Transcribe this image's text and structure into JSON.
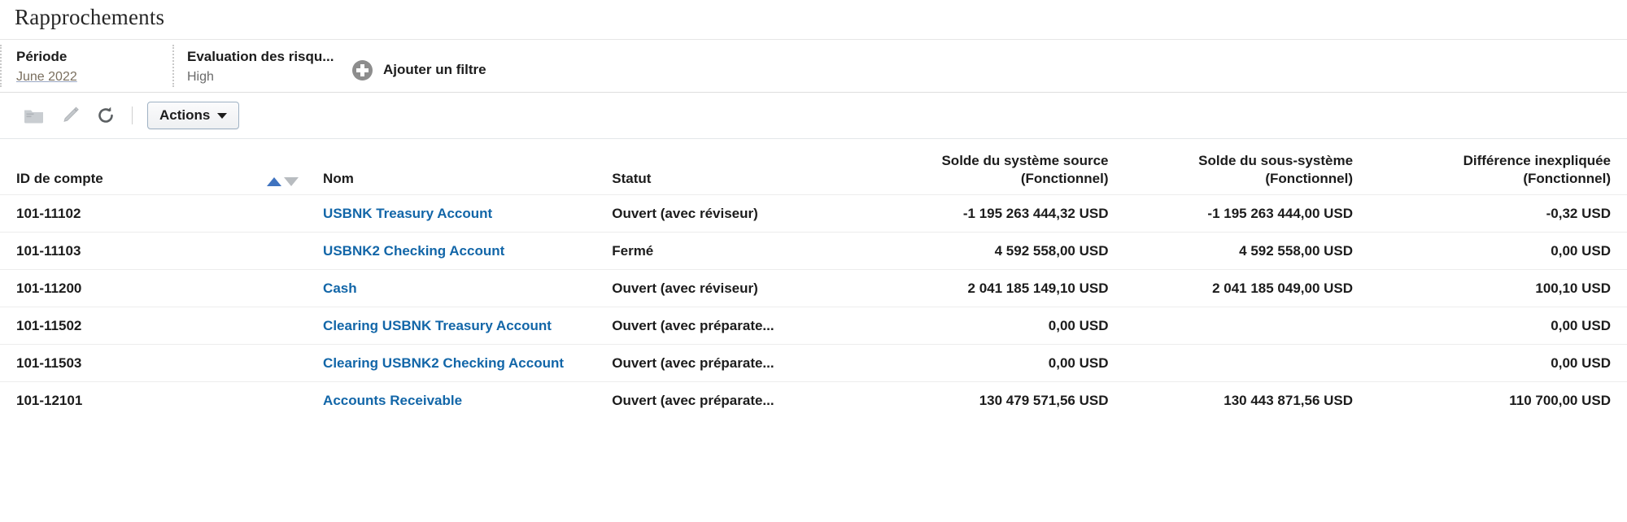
{
  "page": {
    "title": "Rapprochements"
  },
  "filters": {
    "chips": [
      {
        "label": "Période",
        "value": "June 2022",
        "is_link": true
      },
      {
        "label": "Evaluation des risqu...",
        "value": "High",
        "is_link": false
      }
    ],
    "add_filter": {
      "label": "Ajouter un filtre",
      "icon": "plus-circle-icon"
    }
  },
  "toolbar": {
    "icons": [
      {
        "name": "folder-icon",
        "title": "Dossier"
      },
      {
        "name": "edit-pencil-icon",
        "title": "Modifier"
      },
      {
        "name": "refresh-icon",
        "title": "Actualiser"
      }
    ],
    "actions_label": "Actions",
    "actions_caret": "caret-down-icon"
  },
  "grid": {
    "sort": {
      "ascending_icon": "sort-ascending-icon",
      "descending_icon": "sort-descending-icon",
      "active": "ascending"
    },
    "columns": [
      {
        "key": "id",
        "label": "ID de compte",
        "sub": "",
        "align": "left"
      },
      {
        "key": "name",
        "label": "Nom",
        "sub": "",
        "align": "left"
      },
      {
        "key": "status",
        "label": "Statut",
        "sub": "",
        "align": "left"
      },
      {
        "key": "src",
        "label": "Solde du système source",
        "sub": "(Fonctionnel)",
        "align": "right"
      },
      {
        "key": "sub",
        "label": "Solde du sous-système",
        "sub": "(Fonctionnel)",
        "align": "right"
      },
      {
        "key": "diff",
        "label": "Différence inexpliquée",
        "sub": "(Fonctionnel)",
        "align": "right"
      }
    ],
    "rows": [
      {
        "id": "101-11102",
        "name": "USBNK Treasury Account",
        "status": "Ouvert (avec réviseur)",
        "src": "-1 195 263 444,32 USD",
        "sub": "-1 195 263 444,00 USD",
        "diff": "-0,32 USD"
      },
      {
        "id": "101-11103",
        "name": "USBNK2 Checking Account",
        "status": "Fermé",
        "src": "4 592 558,00 USD",
        "sub": "4 592 558,00 USD",
        "diff": "0,00 USD"
      },
      {
        "id": "101-11200",
        "name": "Cash",
        "status": "Ouvert (avec réviseur)",
        "src": "2 041 185 149,10 USD",
        "sub": "2 041 185 049,00 USD",
        "diff": "100,10 USD"
      },
      {
        "id": "101-11502",
        "name": "Clearing USBNK Treasury Account",
        "status": "Ouvert (avec préparate...",
        "src": "0,00 USD",
        "sub": "",
        "diff": "0,00 USD"
      },
      {
        "id": "101-11503",
        "name": "Clearing USBNK2 Checking Account",
        "status": "Ouvert (avec préparate...",
        "src": "0,00 USD",
        "sub": "",
        "diff": "0,00 USD"
      },
      {
        "id": "101-12101",
        "name": "Accounts Receivable",
        "status": "Ouvert (avec préparate...",
        "src": "130 479 571,56 USD",
        "sub": "130 443 871,56 USD",
        "diff": "110 700,00 USD"
      }
    ]
  },
  "colors": {
    "link": "#1266a8",
    "sort_active": "#3f73bf",
    "sort_inactive": "#b8bcc0",
    "text": "#1c1c1c",
    "muted": "#6a6a6a",
    "row_divider": "#ededed"
  }
}
